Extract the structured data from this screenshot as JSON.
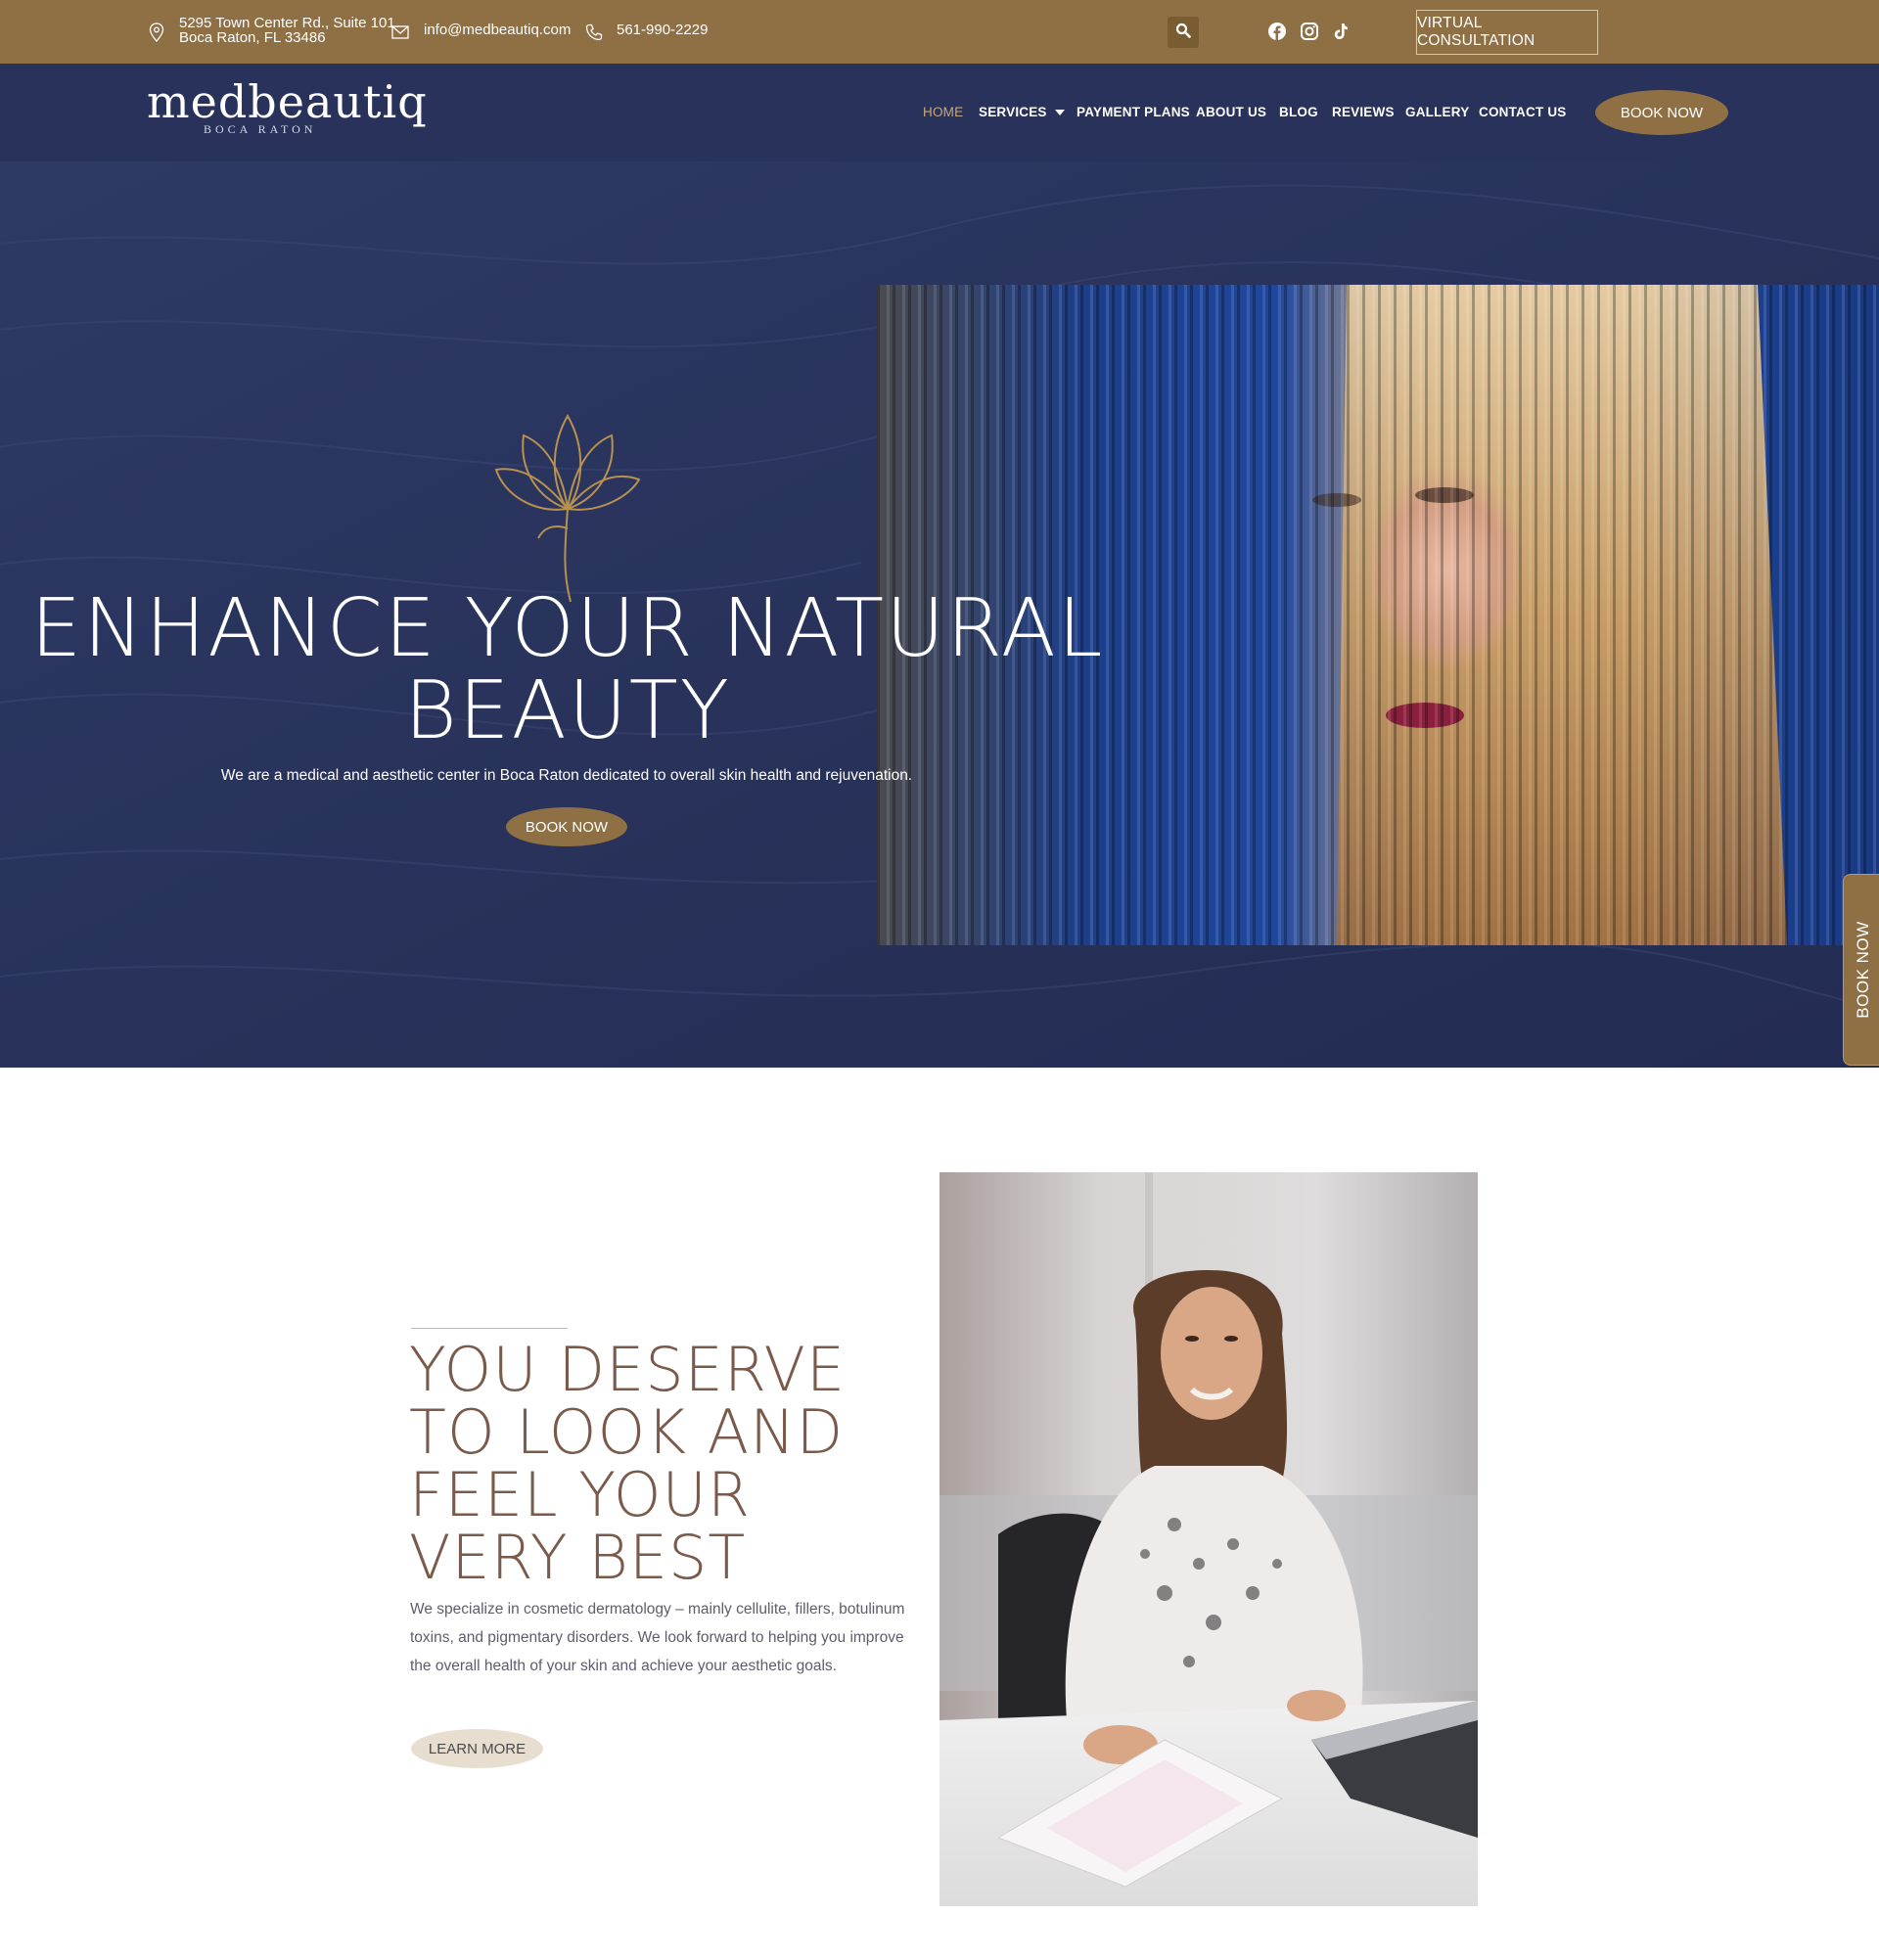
{
  "topbar": {
    "address_line1": "5295 Town Center Rd., Suite 101.",
    "address_line2": "Boca Raton, FL 33486",
    "email": "info@medbeautiq.com",
    "phone": "561-990-2229",
    "virtual_consultation": "VIRTUAL CONSULTATION",
    "icons": [
      "location-pin-icon",
      "mail-icon",
      "phone-icon",
      "search-icon",
      "facebook-icon",
      "instagram-icon",
      "tiktok-icon"
    ]
  },
  "nav": {
    "logo_word": "medbeautiq",
    "logo_sub": "BOCA RATON",
    "items": [
      {
        "label": "HOME",
        "active": true
      },
      {
        "label": "SERVICES",
        "dropdown": true
      },
      {
        "label": "PAYMENT PLANS"
      },
      {
        "label": "ABOUT US"
      },
      {
        "label": "BLOG"
      },
      {
        "label": "REVIEWS"
      },
      {
        "label": "GALLERY"
      },
      {
        "label": "CONTACT US"
      }
    ],
    "book_now": "BOOK NOW"
  },
  "hero": {
    "title_line1": "ENHANCE YOUR NATURAL",
    "title_line2": "BEAUTY",
    "subtitle": "We are a medical and aesthetic center in Boca Raton dedicated to overall skin health and rejuvenation.",
    "book_now": "BOOK NOW",
    "side_tab": "BOOK NOW"
  },
  "about": {
    "title_lines": [
      "YOU DESERVE",
      "TO LOOK AND",
      "FEEL YOUR",
      "VERY BEST"
    ],
    "text": "We specialize in cosmetic dermatology – mainly cellulite, fillers, botulinum toxins, and pigmentary disorders.  We look forward to helping you improve the overall health of your skin and achieve your aesthetic goals.",
    "learn_more": "LEARN MORE"
  },
  "colors": {
    "topbar_gold": "#8f7045",
    "navy": "#28325a",
    "accent_gold": "#c9a877",
    "title_brown": "#7a5a4b",
    "learn_more_bg": "#e8ded0"
  }
}
